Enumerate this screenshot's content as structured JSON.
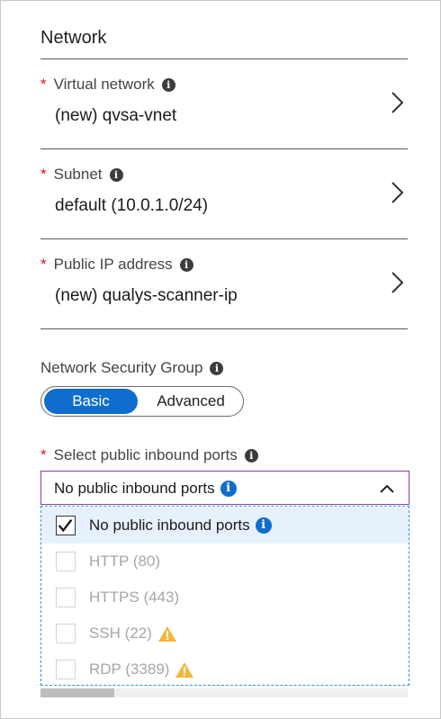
{
  "section": {
    "title": "Network"
  },
  "fields": {
    "vnet": {
      "required": "*",
      "label": "Virtual network",
      "value": "(new) qvsa-vnet"
    },
    "subnet": {
      "required": "*",
      "label": "Subnet",
      "value": "default (10.0.1.0/24)"
    },
    "pip": {
      "required": "*",
      "label": "Public IP address",
      "value": "(new) qualys-scanner-ip"
    }
  },
  "nsg": {
    "label": "Network Security Group",
    "options": [
      "Basic",
      "Advanced"
    ],
    "selected": "Basic"
  },
  "ports": {
    "required": "*",
    "label": "Select public inbound ports",
    "selected_value": "No public inbound ports",
    "items": [
      {
        "label": "No public inbound ports",
        "checked": true,
        "enabled": true,
        "icon": "info-icon"
      },
      {
        "label": "HTTP (80)",
        "checked": false,
        "enabled": false,
        "icon": ""
      },
      {
        "label": "HTTPS (443)",
        "checked": false,
        "enabled": false,
        "icon": ""
      },
      {
        "label": "SSH (22)",
        "checked": false,
        "enabled": false,
        "icon": "warning-icon"
      },
      {
        "label": "RDP (3389)",
        "checked": false,
        "enabled": false,
        "icon": "warning-icon"
      }
    ]
  },
  "icons": {
    "info": "i"
  },
  "colors": {
    "accent": "#0f6ecd",
    "required": "#e00b1c",
    "focus_border": "#8c3ea5",
    "warning": "#f3b73a"
  }
}
